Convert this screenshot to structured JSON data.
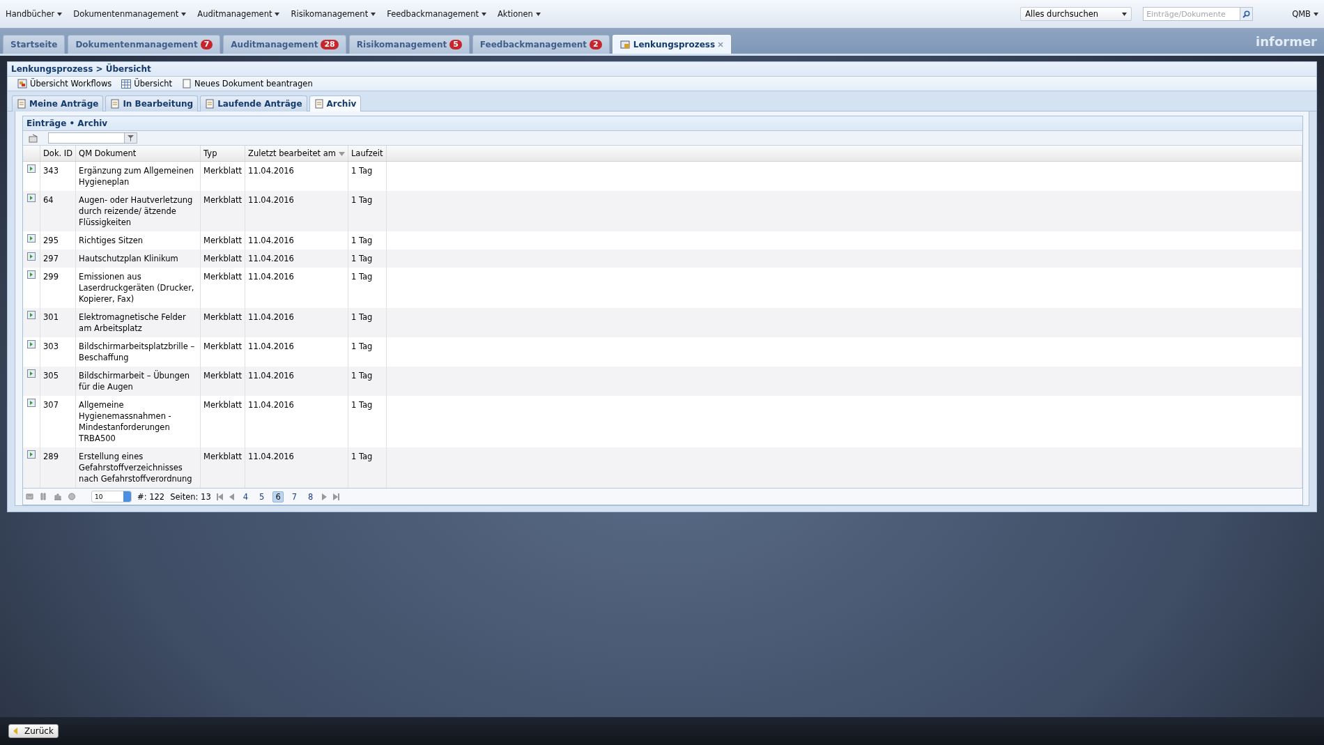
{
  "menu": [
    {
      "label": "Handbücher"
    },
    {
      "label": "Dokumentenmanagement"
    },
    {
      "label": "Auditmanagement"
    },
    {
      "label": "Risikomanagement"
    },
    {
      "label": "Feedbackmanagement"
    },
    {
      "label": "Aktionen"
    }
  ],
  "search": {
    "scope": "Alles durchsuchen",
    "placeholder": "Einträge/Dokumente"
  },
  "user": "QMB",
  "tabs": [
    {
      "label": "Startseite",
      "selected": false
    },
    {
      "label": "Dokumentenmanagement",
      "badge": "7",
      "selected": false
    },
    {
      "label": "Auditmanagement",
      "badge": "28",
      "selected": false
    },
    {
      "label": "Risikomanagement",
      "badge": "5",
      "selected": false
    },
    {
      "label": "Feedbackmanagement",
      "badge": "2",
      "selected": false
    },
    {
      "label": "Lenkungsprozess",
      "selected": true,
      "closable": true
    }
  ],
  "logo": "informer",
  "breadcrumb": "Lenkungsprozess > Übersicht",
  "toolbar": [
    {
      "label": "Übersicht Workflows",
      "kind": "workflows"
    },
    {
      "label": "Übersicht",
      "kind": "grid"
    },
    {
      "label": "Neues Dokument beantragen",
      "kind": "document"
    }
  ],
  "subtabs": [
    {
      "label": "Meine Anträge",
      "selected": false
    },
    {
      "label": "In Bearbeitung",
      "selected": false
    },
    {
      "label": "Laufende Anträge",
      "selected": false
    },
    {
      "label": "Archiv",
      "selected": true
    }
  ],
  "panel_title": "Einträge • Archiv",
  "table": {
    "columns": [
      {
        "label": "Dok. ID"
      },
      {
        "label": "QM Dokument"
      },
      {
        "label": "Typ"
      },
      {
        "label": "Zuletzt bearbeitet am",
        "sorted": true
      },
      {
        "label": "Laufzeit"
      }
    ],
    "rows": [
      [
        "343",
        "Ergänzung zum Allgemeinen Hygieneplan",
        "Merkblatt",
        "11.04.2016",
        "1 Tag"
      ],
      [
        "64",
        "Augen- oder Hautverletzung durch reizende/ ätzende Flüssigkeiten",
        "Merkblatt",
        "11.04.2016",
        "1 Tag"
      ],
      [
        "295",
        "Richtiges Sitzen",
        "Merkblatt",
        "11.04.2016",
        "1 Tag"
      ],
      [
        "297",
        "Hautschutzplan Klinikum",
        "Merkblatt",
        "11.04.2016",
        "1 Tag"
      ],
      [
        "299",
        "Emissionen aus Laserdruckgeräten (Drucker, Kopierer, Fax)",
        "Merkblatt",
        "11.04.2016",
        "1 Tag"
      ],
      [
        "301",
        "Elektromagnetische Felder am Arbeitsplatz",
        "Merkblatt",
        "11.04.2016",
        "1 Tag"
      ],
      [
        "303",
        "Bildschirmarbeitsplatzbrille – Beschaffung",
        "Merkblatt",
        "11.04.2016",
        "1 Tag"
      ],
      [
        "305",
        "Bildschirmarbeit – Übungen für die Augen",
        "Merkblatt",
        "11.04.2016",
        "1 Tag"
      ],
      [
        "307",
        "Allgemeine Hygienemassnahmen - Mindestanforderungen TRBA500",
        "Merkblatt",
        "11.04.2016",
        "1 Tag"
      ],
      [
        "289",
        "Erstellung eines Gefahrstoffverzeichnisses nach Gefahrstoffverordnung",
        "Merkblatt",
        "11.04.2016",
        "1 Tag"
      ]
    ]
  },
  "pager": {
    "page_size": "10",
    "count": "#: 122",
    "pages": "Seiten: 13",
    "links": [
      {
        "label": "4",
        "selected": false
      },
      {
        "label": "5",
        "selected": false
      },
      {
        "label": "6",
        "selected": true
      },
      {
        "label": "7",
        "selected": false
      },
      {
        "label": "8",
        "selected": false
      }
    ]
  },
  "back_button": "Zurück"
}
